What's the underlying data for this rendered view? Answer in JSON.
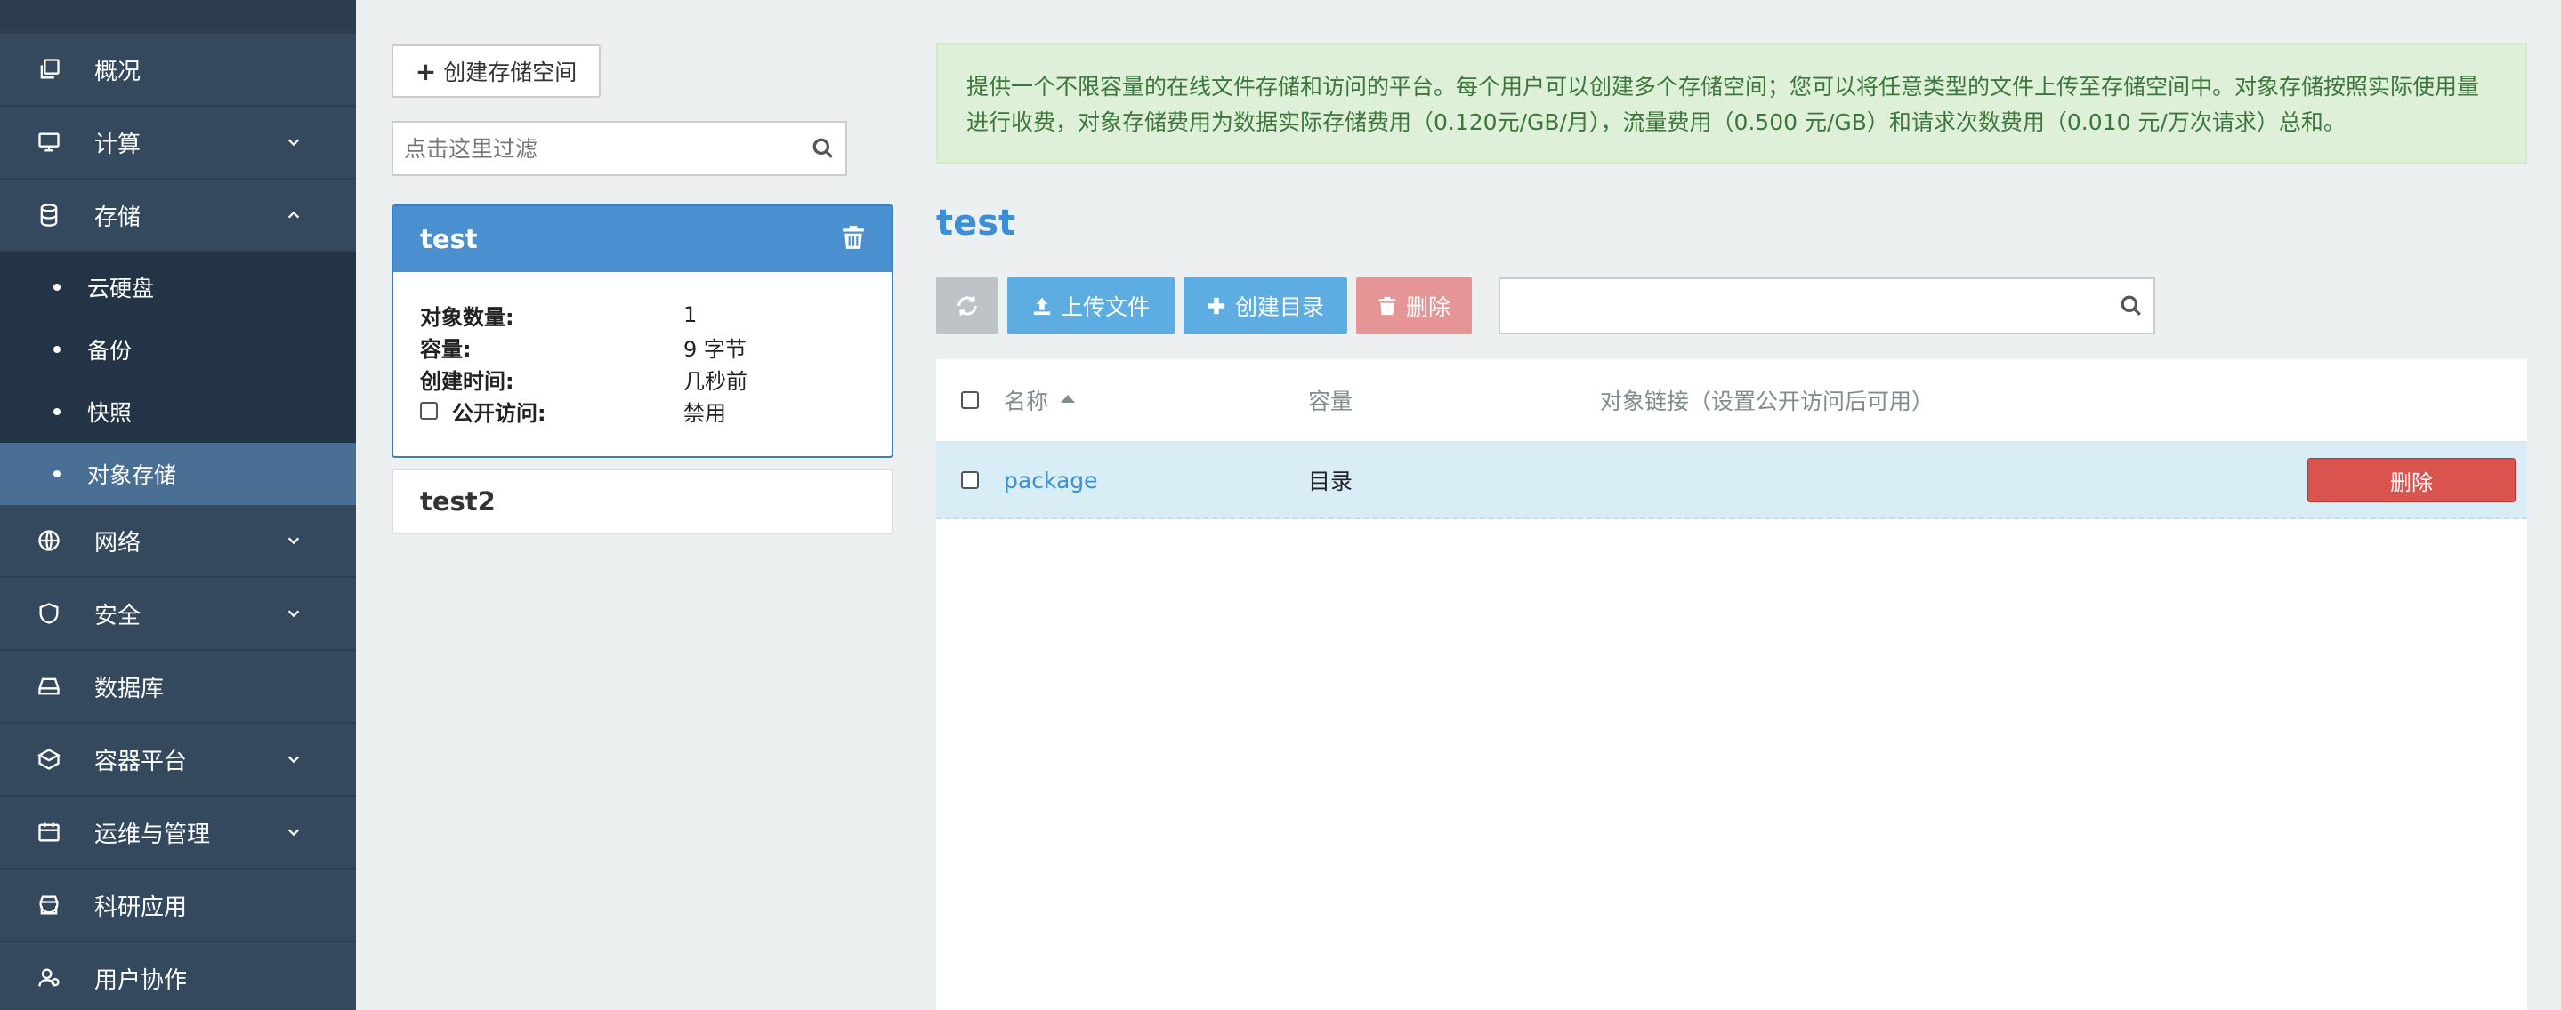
{
  "sidebar": {
    "items": [
      {
        "label": "概况"
      },
      {
        "label": "计算"
      },
      {
        "label": "存储"
      },
      {
        "label": "网络"
      },
      {
        "label": "安全"
      },
      {
        "label": "数据库"
      },
      {
        "label": "容器平台"
      },
      {
        "label": "运维与管理"
      },
      {
        "label": "科研应用"
      },
      {
        "label": "用户协作"
      }
    ],
    "storage_submenu": [
      {
        "label": "云硬盘"
      },
      {
        "label": "备份"
      },
      {
        "label": "快照"
      },
      {
        "label": "对象存储",
        "active": true
      }
    ]
  },
  "buckets": {
    "create_label": "创建存储空间",
    "filter_placeholder": "点击这里过滤",
    "selected": {
      "name": "test",
      "object_count_label": "对象数量:",
      "object_count": "1",
      "capacity_label": "容量:",
      "capacity": "9 字节",
      "created_label": "创建时间:",
      "created": "几秒前",
      "public_label": "公开访问:",
      "public": "禁用"
    },
    "other": {
      "name": "test2"
    }
  },
  "main": {
    "banner": "提供一个不限容量的在线文件存储和访问的平台。每个用户可以创建多个存储空间；您可以将任意类型的文件上传至存储空间中。对象存储按照实际使用量进行收费，对象存储费用为数据实际存储费用（0.120元/GB/月），流量费用（0.500 元/GB）和请求次数费用（0.010 元/万次请求）总和。",
    "title": "test",
    "toolbar": {
      "upload_label": "上传文件",
      "mkdir_label": "创建目录",
      "delete_label": "删除"
    },
    "table": {
      "headers": {
        "name": "名称",
        "size": "容量",
        "link": "对象链接（设置公开访问后可用）"
      },
      "rows": [
        {
          "name": "package",
          "size": "目录",
          "action": "删除"
        }
      ]
    }
  },
  "colors": {
    "sidebar_bg": "#34495e",
    "primary": "#4a8fd0",
    "danger": "#d9534f",
    "banner_bg": "#dff0d8"
  }
}
